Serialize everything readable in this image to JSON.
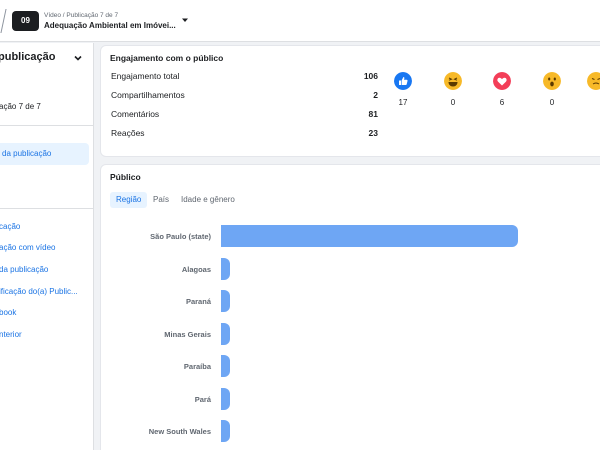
{
  "topbar": {
    "badge": "09",
    "breadcrumb": "Vídeo / Publicação 7 de 7",
    "title": "Adequação Ambiental em Imóvei..."
  },
  "sidebar": {
    "heading": "publicação",
    "subtitle": "ação 7 de 7",
    "active_item": "da publicação",
    "links": [
      "cação",
      "ação com vídeo",
      "da publicação",
      "ificação do(a) Public...",
      "book",
      "nterior"
    ]
  },
  "engagement": {
    "title": "Engajamento com o público",
    "rows": [
      {
        "label": "Engajamento total",
        "value": "106"
      },
      {
        "label": "Compartilhamentos",
        "value": "2"
      },
      {
        "label": "Comentários",
        "value": "81"
      },
      {
        "label": "Reações",
        "value": "23"
      }
    ],
    "reactions": [
      {
        "icon": "like-icon",
        "count": "17"
      },
      {
        "icon": "haha-icon",
        "count": "0"
      },
      {
        "icon": "love-icon",
        "count": "6"
      },
      {
        "icon": "wow-icon",
        "count": "0"
      },
      {
        "icon": "care-icon",
        "count": ""
      }
    ]
  },
  "audience": {
    "title": "Público",
    "tabs": [
      "Região",
      "País",
      "Idade e gênero"
    ],
    "active_tab": "Região"
  },
  "chart_data": {
    "type": "bar",
    "orientation": "horizontal",
    "categories": [
      "São Paulo (state)",
      "Alagoas",
      "Paraná",
      "Minas Gerais",
      "Paraíba",
      "Pará",
      "New South Wales"
    ],
    "values": [
      100,
      3,
      3,
      3,
      3,
      3,
      3
    ],
    "unit": "relative",
    "xlim": [
      0,
      100
    ],
    "color": "#6ea6f4"
  }
}
